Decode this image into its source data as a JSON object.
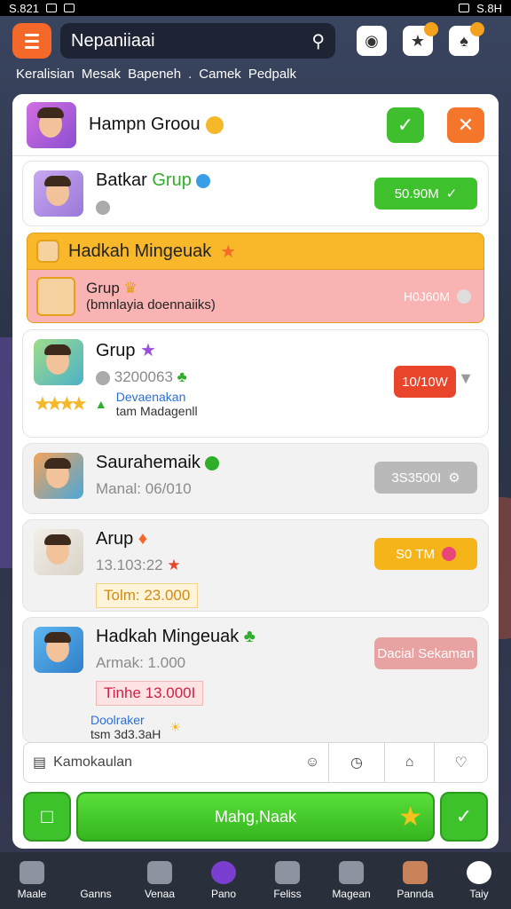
{
  "status": {
    "left": "S.821",
    "right": "S.8H"
  },
  "search": {
    "placeholder": "Nepaniiaai"
  },
  "tabs": [
    "Keralisian",
    "Mesak",
    "Bapeneh",
    ".",
    "Camek",
    "Pedpalk"
  ],
  "header": {
    "title": "Hampn Groou"
  },
  "rows": [
    {
      "name_a": "Batkar ",
      "name_b": "Grup",
      "pill": "50.90M"
    },
    {
      "bar_title": "Hadkah Mingeuak",
      "title": "Grup",
      "desc": "(bmnlayia doennaiiks)",
      "right": "H0J60M"
    },
    {
      "name": "Grup",
      "id": "3200063",
      "badge": "Devaenakan",
      "badge2": "tam Madagenll",
      "pill": "10/10W"
    },
    {
      "name": "Saurahemaik",
      "sub": "Manal: 06/010",
      "pill": "3S3500I"
    },
    {
      "name": "Arup",
      "sub": "13.103:22",
      "price": "Tolm: 23.000",
      "pill": "S0 TM"
    },
    {
      "name": "Hadkah Mingeuak",
      "sub": "Armak: 1.000",
      "price": "Tinhe 13.000I",
      "badge": "Doolraker",
      "badge2": "tsm 3d3.3aH",
      "pill": "Dacial Sekaman"
    }
  ],
  "footer": {
    "label": "Kamokaulan"
  },
  "cta": {
    "label": "Mahg,Naak"
  },
  "nav": [
    "Maale",
    "Ganns",
    "Venaa",
    "Pano",
    "Feliss",
    "Magean",
    "Pannda",
    "Taiy"
  ]
}
